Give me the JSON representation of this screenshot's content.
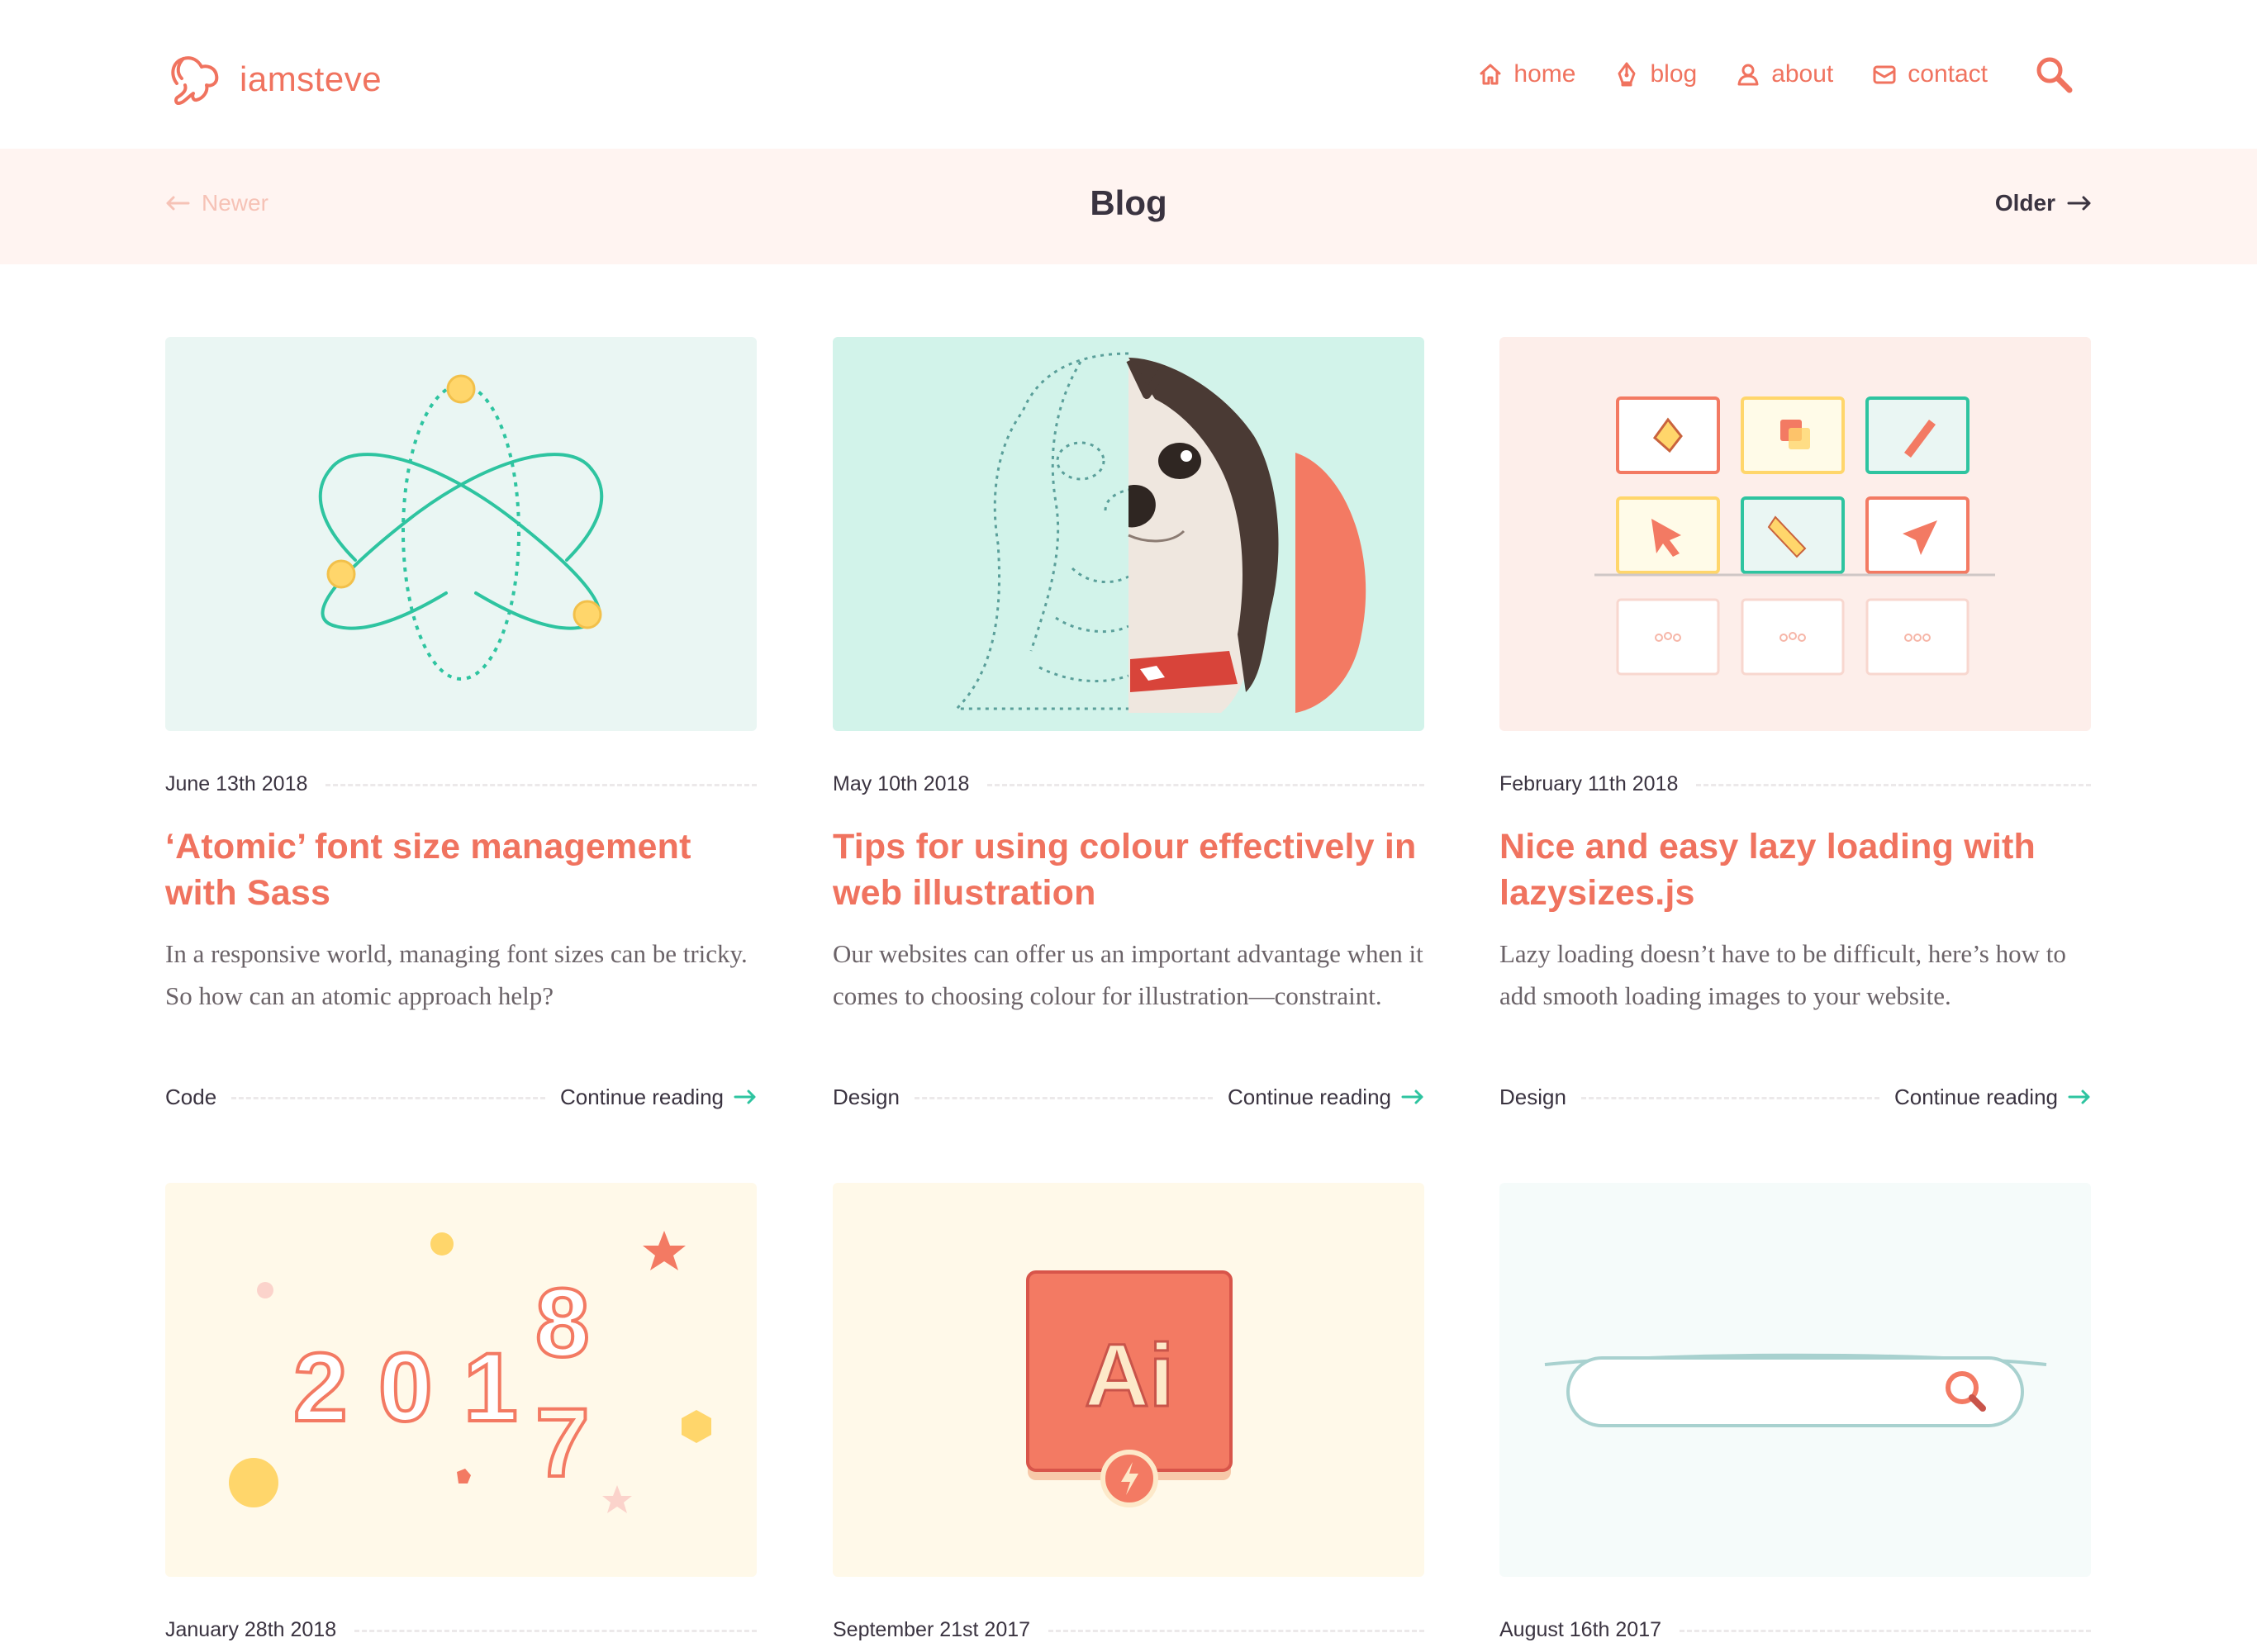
{
  "header": {
    "logo_text": "iamsteve",
    "nav": [
      {
        "label": "home",
        "icon": "home-icon"
      },
      {
        "label": "blog",
        "icon": "pen-nib-icon"
      },
      {
        "label": "about",
        "icon": "person-icon"
      },
      {
        "label": "contact",
        "icon": "envelope-icon"
      }
    ],
    "search_icon": "search-icon"
  },
  "pager": {
    "newer_label": "Newer",
    "title": "Blog",
    "older_label": "Older"
  },
  "colors": {
    "accent": "#f0735f",
    "teal": "#2ec4a0",
    "text": "#3a3340",
    "pager_bg": "#fff4f1"
  },
  "posts": [
    {
      "date": "June 13th 2018",
      "title": "‘Atomic’ font size management with Sass",
      "excerpt": "In a responsive world, managing font sizes can be tricky. So how can an atomic approach help?",
      "tag": "Code",
      "cta": "Continue reading",
      "image": "atom-illustration"
    },
    {
      "date": "May 10th 2018",
      "title": "Tips for using colour effectively in web illustration",
      "excerpt": "Our websites can offer us an important advantage when it comes to choosing colour for illustration—constraint.",
      "tag": "Design",
      "cta": "Continue reading",
      "image": "dog-illustration"
    },
    {
      "date": "February 11th 2018",
      "title": "Nice and easy lazy loading with lazysizes.js",
      "excerpt": "Lazy loading doesn’t have to be difficult, here’s how to add smooth loading images to your website.",
      "tag": "Design",
      "cta": "Continue reading",
      "image": "tool-grid-illustration"
    },
    {
      "date": "January 28th 2018",
      "image": "year-2018-illustration",
      "image_text": [
        "2",
        "0",
        "1",
        "8",
        "7"
      ]
    },
    {
      "date": "September 21st 2017",
      "image": "illustrator-app-illustration",
      "image_text": "Ai"
    },
    {
      "date": "August 16th 2017",
      "image": "search-bar-illustration"
    }
  ]
}
